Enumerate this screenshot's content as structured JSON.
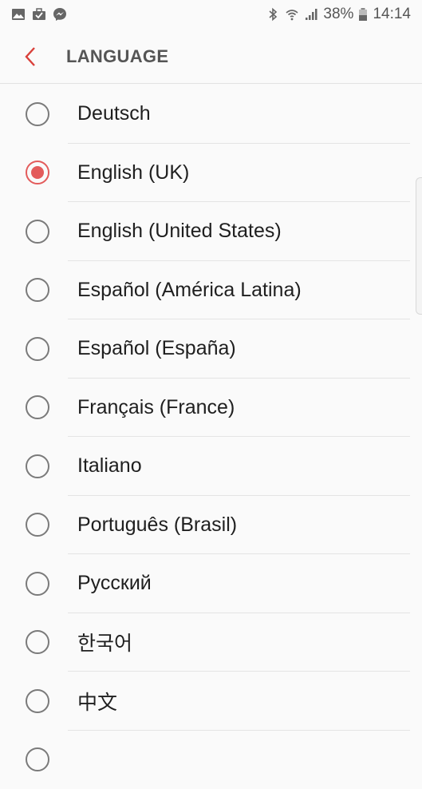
{
  "status_bar": {
    "battery_percent": "38%",
    "time": "14:14",
    "left_icons": [
      "gallery-icon",
      "briefcase-icon",
      "messenger-icon"
    ],
    "right_icons": [
      "bluetooth-icon",
      "wifi-icon",
      "signal-icon",
      "battery-icon"
    ]
  },
  "header": {
    "title": "LANGUAGE",
    "back_icon": "chevron-left-icon",
    "accent_color": "#d9403a"
  },
  "languages": {
    "selected_index": 1,
    "items": [
      {
        "label": "Deutsch",
        "selected": false
      },
      {
        "label": "English (UK)",
        "selected": true
      },
      {
        "label": "English (United States)",
        "selected": false
      },
      {
        "label": "Español (América Latina)",
        "selected": false
      },
      {
        "label": "Español (España)",
        "selected": false
      },
      {
        "label": "Français (France)",
        "selected": false
      },
      {
        "label": "Italiano",
        "selected": false
      },
      {
        "label": "Português (Brasil)",
        "selected": false
      },
      {
        "label": "Русский",
        "selected": false
      },
      {
        "label": "한국어",
        "selected": false
      },
      {
        "label": "中文",
        "selected": false
      }
    ]
  }
}
